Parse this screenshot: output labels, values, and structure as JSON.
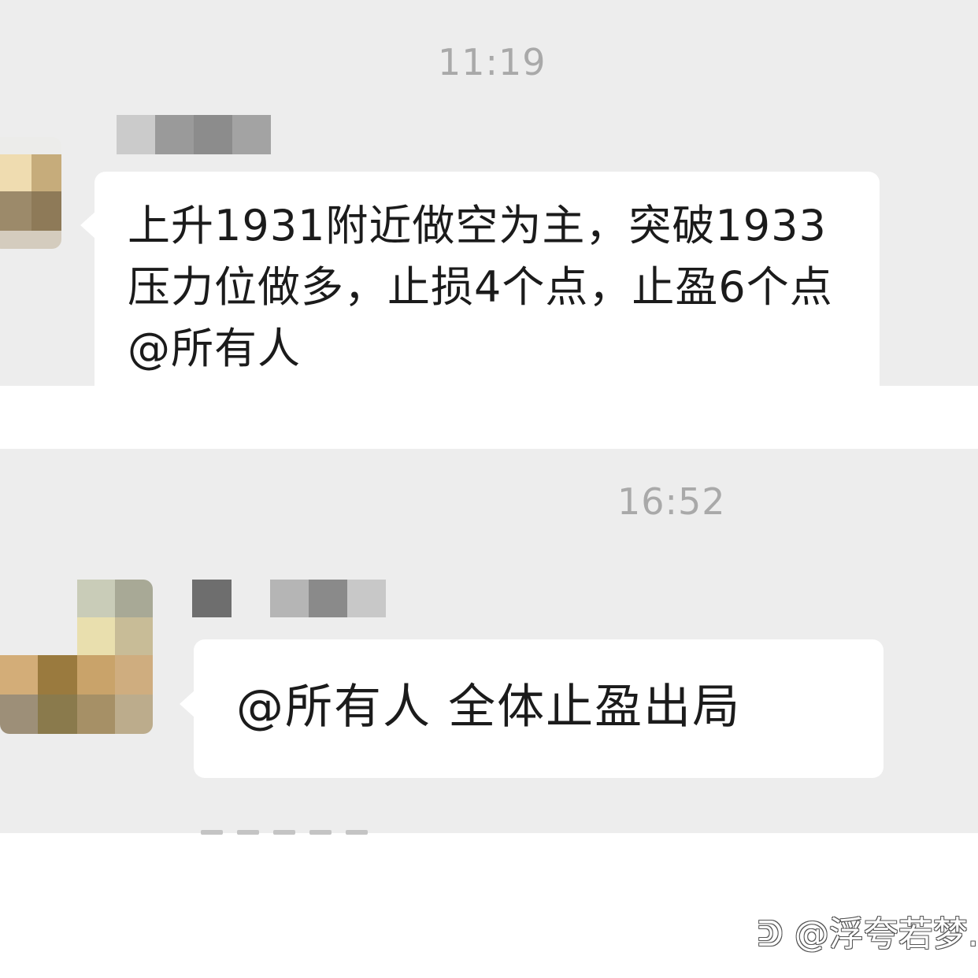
{
  "chat": {
    "messages": [
      {
        "time": "11:19",
        "text": "上升1931附近做空为主，突破1933压力位做多，止损4个点，止盈6个点@所有人"
      },
      {
        "time": "16:52",
        "text": "@所有人 全体止盈出局"
      }
    ]
  },
  "watermark": "@浮夸若梦.",
  "icons": {
    "avatar_1": "pixelated-avatar",
    "avatar_2": "pixelated-avatar",
    "name_1": "pixelated-sender-name",
    "name_2": "pixelated-sender-name",
    "watermark_logo": "platform-logo-icon"
  },
  "colors": {
    "chat_background": "#ededed",
    "bubble": "#ffffff",
    "timestamp": "#a9a9a9",
    "message_text": "#1b1b1b"
  }
}
